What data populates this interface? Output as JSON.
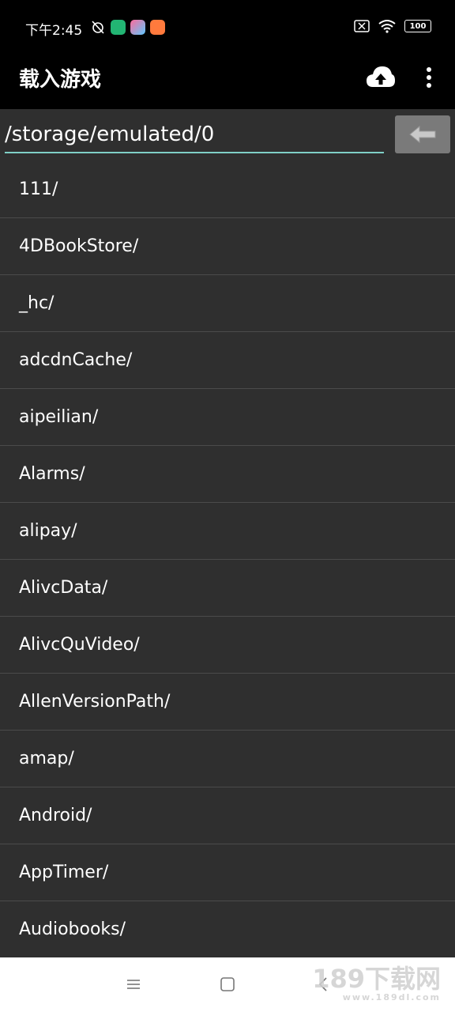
{
  "status_bar": {
    "time": "下午2:45",
    "battery": "100"
  },
  "app_bar": {
    "title": "载入游戏",
    "upload_icon": "cloud-upload-icon",
    "more_icon": "more-vert-icon"
  },
  "path_bar": {
    "path": "/storage/emulated/0",
    "back_icon": "arrow-left-icon"
  },
  "files": [
    "111/",
    "4DBookStore/",
    "_hc/",
    "adcdnCache/",
    "aipeilian/",
    "Alarms/",
    "alipay/",
    "AlivcData/",
    "AlivcQuVideo/",
    "AllenVersionPath/",
    "amap/",
    "Android/",
    "AppTimer/",
    "Audiobooks/"
  ],
  "watermark": {
    "text": "189下载网",
    "sub": "www.189dl.com"
  },
  "colors": {
    "accent_underline": "#7fcfc6",
    "background": "#2f2f2f",
    "appbar": "#000000"
  }
}
